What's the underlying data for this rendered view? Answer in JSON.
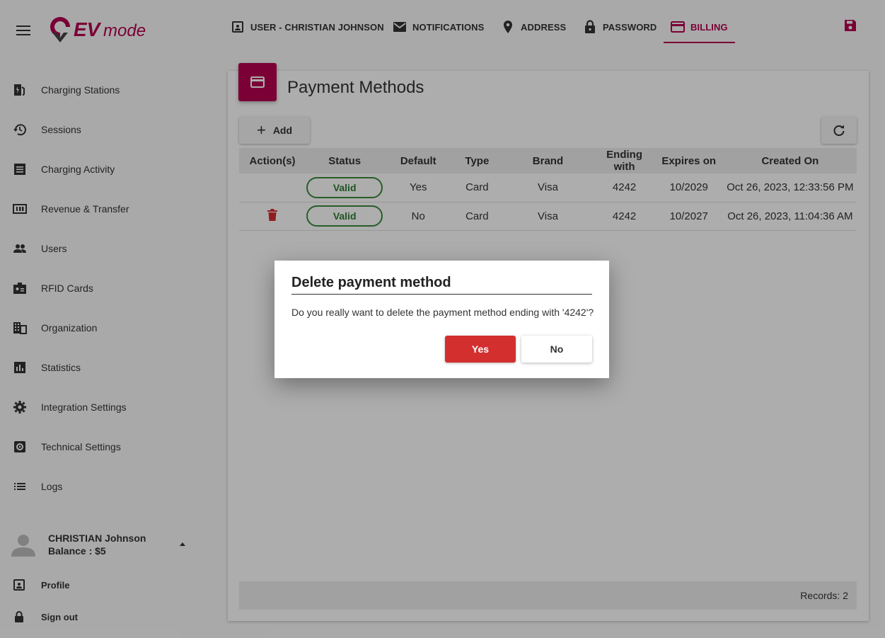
{
  "brand": {
    "logo_text": "EVmode",
    "accent_color": "#b4004e"
  },
  "sidebar": {
    "items": [
      {
        "label": "Charging Stations",
        "icon": "ev-station-icon"
      },
      {
        "label": "Sessions",
        "icon": "history-icon"
      },
      {
        "label": "Charging Activity",
        "icon": "receipt-icon"
      },
      {
        "label": "Revenue & Transfer",
        "icon": "money-icon"
      },
      {
        "label": "Users",
        "icon": "users-icon"
      },
      {
        "label": "RFID Cards",
        "icon": "badge-icon"
      },
      {
        "label": "Organization",
        "icon": "building-icon"
      },
      {
        "label": "Statistics",
        "icon": "bar-chart-icon"
      },
      {
        "label": "Integration Settings",
        "icon": "gear-icon"
      },
      {
        "label": "Technical Settings",
        "icon": "settings-box-icon"
      },
      {
        "label": "Logs",
        "icon": "list-icon"
      }
    ],
    "user": {
      "name": "CHRISTIAN Johnson",
      "balance": "Balance : $5"
    },
    "profile_label": "Profile",
    "signout_label": "Sign out"
  },
  "tabs": [
    {
      "label": "USER - CHRISTIAN JOHNSON",
      "icon": "contact-card-icon"
    },
    {
      "label": "NOTIFICATIONS",
      "icon": "mail-icon"
    },
    {
      "label": "ADDRESS",
      "icon": "location-pin-icon"
    },
    {
      "label": "PASSWORD",
      "icon": "lock-icon"
    },
    {
      "label": "BILLING",
      "icon": "credit-card-icon",
      "active": true
    }
  ],
  "payment": {
    "title": "Payment Methods",
    "add_label": "Add",
    "columns": [
      "Action(s)",
      "Status",
      "Default",
      "Type",
      "Brand",
      "Ending with",
      "Expires on",
      "Created On"
    ],
    "rows": [
      {
        "status": "Valid",
        "default": "Yes",
        "type": "Card",
        "brand": "Visa",
        "ending": "4242",
        "expires": "10/2029",
        "created": "Oct 26, 2023, 12:33:56 PM",
        "deletable": false
      },
      {
        "status": "Valid",
        "default": "No",
        "type": "Card",
        "brand": "Visa",
        "ending": "4242",
        "expires": "10/2027",
        "created": "Oct 26, 2023, 11:04:36 AM",
        "deletable": true
      }
    ],
    "records": "Records: 2"
  },
  "dialog": {
    "title": "Delete payment method",
    "message": "Do you really want to delete the payment method ending with '4242'?",
    "yes_label": "Yes",
    "no_label": "No"
  }
}
